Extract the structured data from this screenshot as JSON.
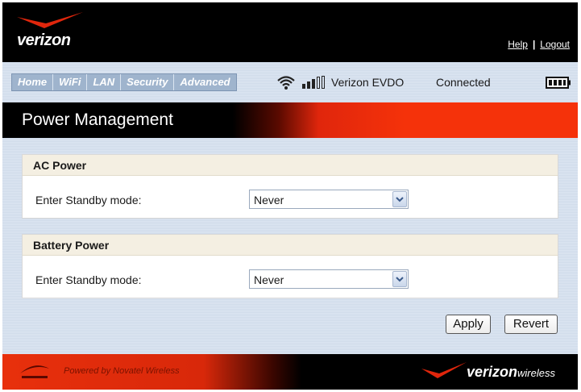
{
  "header": {
    "logo_text": "verizon",
    "help_label": "Help",
    "separator": "|",
    "logout_label": "Logout"
  },
  "nav": {
    "tabs": [
      {
        "label": "Home"
      },
      {
        "label": "WiFi"
      },
      {
        "label": "LAN"
      },
      {
        "label": "Security"
      },
      {
        "label": "Advanced"
      }
    ],
    "network_label": "Verizon EVDO",
    "connection_status": "Connected",
    "icons": {
      "wifi": "wifi-icon",
      "signal": "signal-strength-icon",
      "battery": "battery-icon"
    },
    "signal_bars_filled": 3,
    "signal_bars_total": 5
  },
  "page": {
    "title": "Power Management"
  },
  "sections": {
    "ac": {
      "heading": "AC Power",
      "label": "Enter Standby mode:",
      "value": "Never"
    },
    "battery": {
      "heading": "Battery Power",
      "label": "Enter Standby mode:",
      "value": "Never"
    }
  },
  "actions": {
    "apply_label": "Apply",
    "revert_label": "Revert"
  },
  "footer": {
    "powered_by": "Powered by Novatel Wireless",
    "brand_main": "verizon",
    "brand_sub": "wireless"
  },
  "colors": {
    "header_bg": "#000000",
    "accent_red": "#f5320a",
    "tab_bg": "#9fb4cd",
    "panel_head_bg": "#f4efe2",
    "content_bg": "#cfdbea"
  }
}
